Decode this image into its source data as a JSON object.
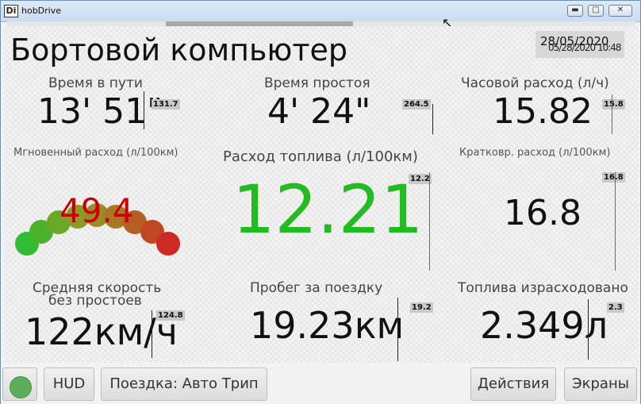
{
  "window": {
    "title": "hobDrive",
    "logo": "Di"
  },
  "header": {
    "title": "Бортовой компьютер",
    "date": "28/05/2020",
    "date_overlap": "05/28/2020 10:48"
  },
  "metrics": {
    "trip_time": {
      "label": "Время в пути",
      "value": "13' 51\"",
      "chip": "131.7"
    },
    "idle_time": {
      "label": "Время простоя",
      "value": "4' 24\"",
      "chip": "264.5"
    },
    "hourly": {
      "label": "Часовой расход (л/ч)",
      "value": "15.82",
      "chip": "15.8"
    },
    "instant": {
      "label": "Мгновенный расход (л/100км)",
      "value": "49.4"
    },
    "fuel": {
      "label": "Расход топлива (л/100км)",
      "value": "12.21",
      "chip": "12.2"
    },
    "short_term": {
      "label": "Кратковр. расход (л/100км)",
      "value": "16.8",
      "chip": "16.8"
    },
    "avg_speed": {
      "label1": "Средняя скорость",
      "label2": "без простоев",
      "value": "122км/ч",
      "chip": "124.8"
    },
    "distance": {
      "label": "Пробег за поездку",
      "value": "19.23км",
      "chip": "19.2"
    },
    "fuel_used": {
      "label": "Топлива израсходовано",
      "value": "2.349л",
      "chip": "2.3"
    }
  },
  "bottom": {
    "hud": "HUD",
    "trip": "Поездка: Авто Трип",
    "actions": "Действия",
    "screens": "Экраны"
  },
  "colors": {
    "fuel_value": "#22bb22",
    "instant_value": "#cc0000",
    "status": "#5cae5c"
  },
  "icons": {
    "minimize": "minimize-icon",
    "maximize": "maximize-icon",
    "close": "close-icon",
    "status": "status-circle-icon"
  }
}
